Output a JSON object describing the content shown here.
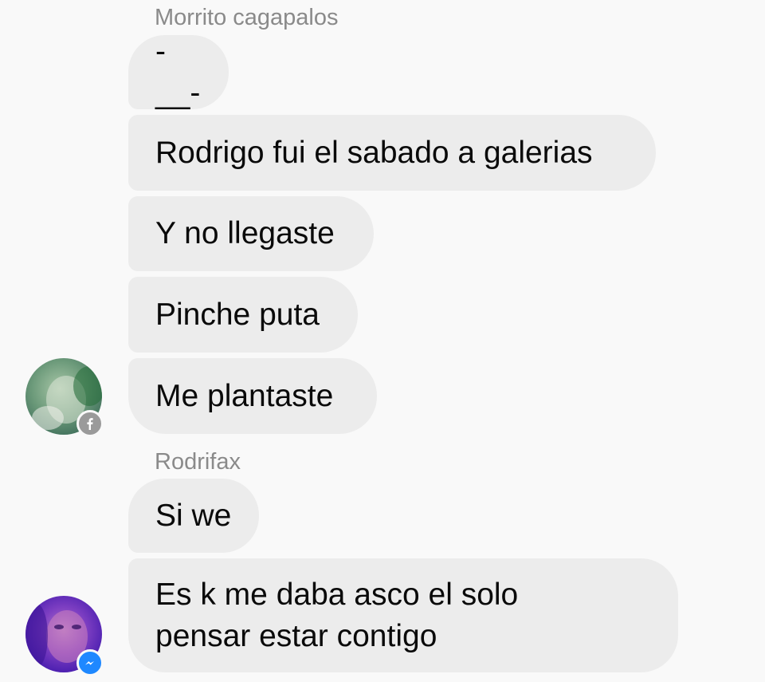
{
  "conversation": {
    "groups": [
      {
        "sender": "Morrito cagapalos",
        "badge": "facebook-icon",
        "messages": [
          "-__-",
          "Rodrigo fui el sabado a galerias",
          "Y no llegaste",
          "Pinche puta",
          "Me plantaste"
        ]
      },
      {
        "sender": "Rodrifax",
        "badge": "messenger-icon",
        "messages": [
          "Si we",
          "Es k me daba asco el solo\npensar estar contigo"
        ]
      }
    ]
  },
  "colors": {
    "background": "#f9f9f9",
    "bubble": "#ececec",
    "sender_text": "#8a8a8a",
    "message_text": "#0a0a0a",
    "facebook_badge": "#9a9a9a",
    "messenger_badge": "#1e88ff"
  }
}
